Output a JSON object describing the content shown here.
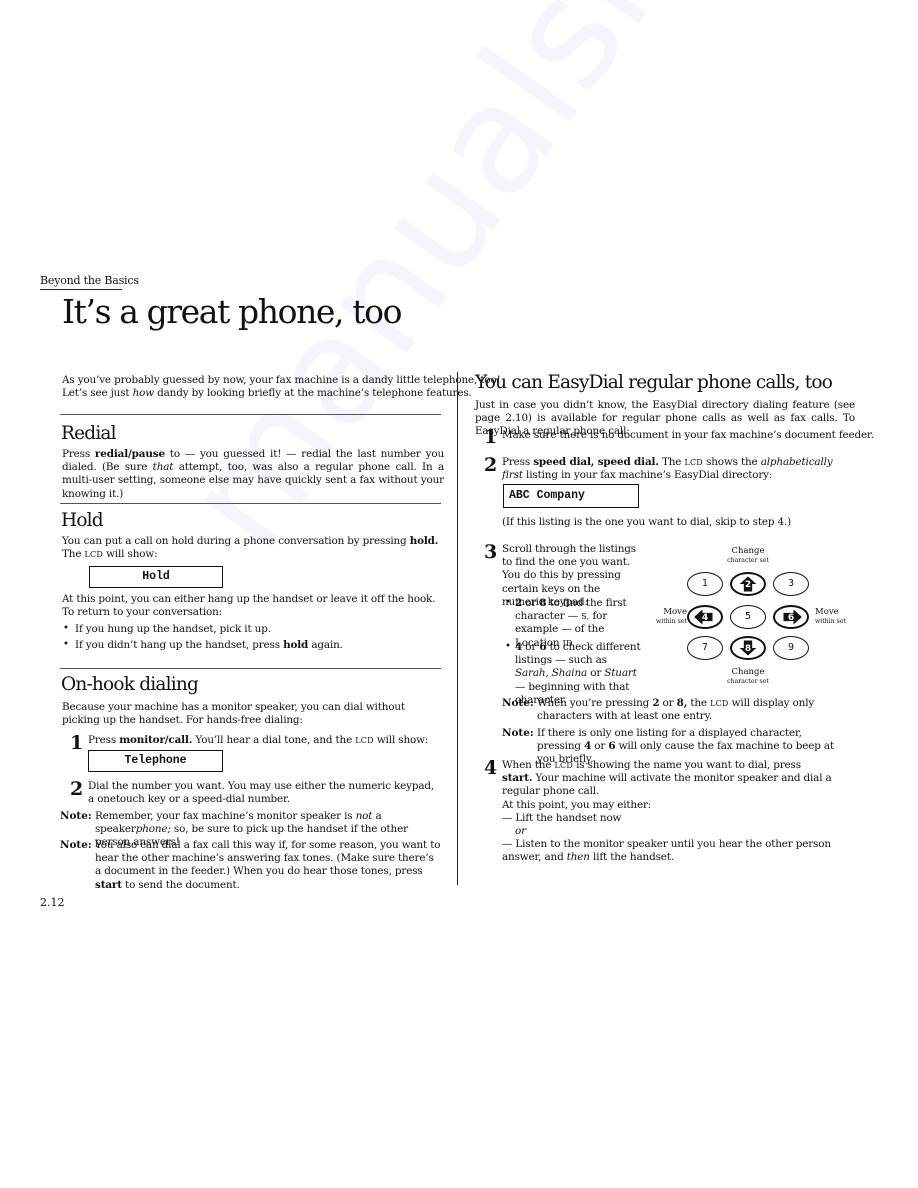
{
  "running_head": "Beyond the Basics",
  "page_title": "It’s a great phone, too",
  "page_number": "2.12",
  "intro": {
    "line1": "As you’ve probably guessed by now, your fax machine is a dandy little telephone, too!",
    "line2_a": "Let’s see just ",
    "line2_em": "how",
    "line2_b": " dandy by looking briefly at the machine’s telephone features."
  },
  "redial": {
    "heading": "Redial",
    "p_a": "Press ",
    "p_key": "redial/pause",
    "p_b": " to — you guessed it! — redial the last number you dialed. (Be sure ",
    "p_em": "that",
    "p_c": " attempt, too, was also a regular phone call. In a multi-user setting, some­one else may have quickly sent a fax without your knowing it.)"
  },
  "hold": {
    "heading": "Hold",
    "p_a": "You can put a call on hold during a phone conversation by pressing ",
    "p_key": "hold.",
    "p_b": " The ",
    "p_lcd": "LCD",
    "p_c": " will show:",
    "lcd_text": "Hold",
    "p2": "At this point, you can either hang up the handset or leave it off the hook. To return to your conversation:",
    "bullets": [
      {
        "text_a": "If you hung up the handset, pick it up.",
        "key": "",
        "text_b": ""
      },
      {
        "text_a": "If you didn’t hang up the handset, press ",
        "key": "hold",
        "text_b": " again."
      }
    ]
  },
  "onhook": {
    "heading": "On-hook dialing",
    "p": "Because your machine has a monitor speaker, you can dial without picking up the handset. For hands-free dialing:",
    "step1": {
      "num": "1",
      "a": "Press ",
      "key": "monitor/call.",
      "b": " You’ll hear a dial tone, and the ",
      "lcd": "LCD",
      "c": " will show:"
    },
    "lcd_text": "Telephone",
    "step2": {
      "num": "2",
      "text": "Dial the number you want. You may use either the numeric keypad, a one­touch key or a speed-dial number."
    },
    "notes": [
      {
        "label": "Note:",
        "a": "Remember, your fax machine’s monitor speaker is ",
        "em1": "not",
        "b": " a speaker",
        "em2": "phone;",
        "c": " so, be sure to pick up the handset if the other person answers!"
      },
      {
        "label": "Note:",
        "a": "You also can dial a fax call this way if, for some reason, you want to hear the other machine’s answering fax tones. (Make sure there’s a document in the feeder.) When you do hear those tones, press ",
        "key": "start",
        "b": " to send the document."
      }
    ]
  },
  "easydial": {
    "heading": "You can EasyDial regular phone calls, too",
    "intro": "Just in case you didn’t know, the EasyDial directory dialing feature (see page 2.10) is available for regular phone calls as well as fax calls. To EasyDial a regular phone call:",
    "step1": {
      "num": "1",
      "text": "Make sure there is no document in your fax machine’s document feeder."
    },
    "step2": {
      "num": "2",
      "a": "Press ",
      "key": "speed dial, speed dial.",
      "b": " The ",
      "lcd": "LCD",
      "c": " shows the ",
      "em": "alphabetically first",
      "d": " listing in your fax machine’s EasyDial directory:"
    },
    "lcd_text": "ABC Company",
    "skip_note": "(If this listing is the one you want to dial, skip to step 4.)",
    "step3": {
      "num": "3",
      "text": "Scroll through the listings to find the one you want. You do this by pressing certain keys on the numeric keypad:",
      "bullets": [
        {
          "k1": "2",
          "or": " or ",
          "k2": "8",
          "a": " to find the first char­acter — ",
          "sc": "S,",
          "b": " for example — of the Location ",
          "sc2": "ID."
        },
        {
          "k1": "4",
          "or": " or ",
          "k2": "6",
          "a": " to check different listings — such as ",
          "em1": "Sarah,",
          "b": " ",
          "em2": "Shaina",
          "c": " or ",
          "em3": "Stuart",
          "d": " — begin­ning with that character."
        }
      ]
    },
    "keypad": {
      "top_label": {
        "big": "Change",
        "small": "character set"
      },
      "bottom_label": {
        "big": "Change",
        "small": "character set"
      },
      "left_label": {
        "big": "Move",
        "small": "within set"
      },
      "right_label": {
        "big": "Move",
        "small": "within set"
      },
      "keys": [
        {
          "label": "1",
          "arrow": "none"
        },
        {
          "label": "2",
          "arrow": "up"
        },
        {
          "label": "3",
          "arrow": "none"
        },
        {
          "label": "4",
          "arrow": "left"
        },
        {
          "label": "5",
          "arrow": "none"
        },
        {
          "label": "6",
          "arrow": "right"
        },
        {
          "label": "7",
          "arrow": "none"
        },
        {
          "label": "8",
          "arrow": "down"
        },
        {
          "label": "9",
          "arrow": "none"
        }
      ]
    },
    "notes": [
      {
        "label": "Note:",
        "a": "When you’re pressing ",
        "k1": "2",
        "or": " or ",
        "k2": "8,",
        "b": " the ",
        "lcd": "LCD",
        "c": " will display only characters with at least one entry."
      },
      {
        "label": "Note:",
        "a": "If there is only one listing for a displayed character, pressing ",
        "k1": "4",
        "or": " or ",
        "k2": "6",
        "b": " will only cause the fax machine to beep at you briefly."
      }
    ],
    "step4": {
      "num": "4",
      "a": "When the ",
      "lcd": "LCD",
      "b": " is showing the name you want to dial, press ",
      "key": "start.",
      "c": " Your machine will activate the monitor speaker and dial a regular phone call.",
      "line2": "At this point, you may either:",
      "opt1": "— Lift the handset now",
      "or": "or",
      "opt2_a": "— Listen to the monitor speaker until you hear the other person answer, and ",
      "opt2_em": "then",
      "opt2_b": " lift the handset."
    }
  }
}
